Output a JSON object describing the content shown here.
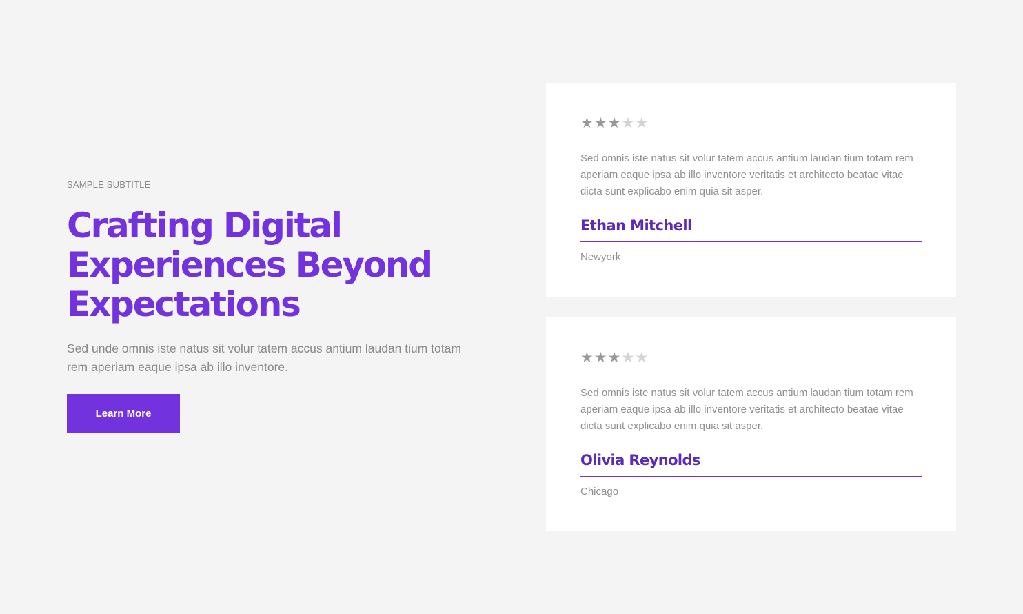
{
  "hero": {
    "subtitle": "SAMPLE SUBTITLE",
    "headline": "Crafting Digital Experiences Beyond Expectations",
    "description": "Sed unde omnis iste natus sit volur tatem accus antium laudan tium totam rem aperiam eaque ipsa ab illo inventore.",
    "button_label": "Learn More"
  },
  "testimonials": [
    {
      "rating": 3,
      "max_rating": 5,
      "quote": "Sed omnis iste natus sit volur tatem accus antium laudan tium totam rem aperiam eaque ipsa ab illo inventore veritatis et architecto beatae vitae dicta sunt explicabo enim quia sit asper.",
      "name": "Ethan Mitchell",
      "location": "Newyork"
    },
    {
      "rating": 3,
      "max_rating": 5,
      "quote": "Sed omnis iste natus sit volur tatem accus antium laudan tium totam rem aperiam eaque ipsa ab illo inventore veritatis et architecto beatae vitae dicta sunt explicabo enim quia sit asper.",
      "name": "Olivia Reynolds",
      "location": "Chicago"
    }
  ],
  "colors": {
    "accent": "#7232dd",
    "name_text": "#5a2bb8",
    "background": "#f4f4f4",
    "card": "#ffffff",
    "muted_text": "#8f8f8f",
    "star_filled": "#999999",
    "star_empty": "#d3d3d3"
  },
  "icons": {
    "star": "star-icon"
  }
}
